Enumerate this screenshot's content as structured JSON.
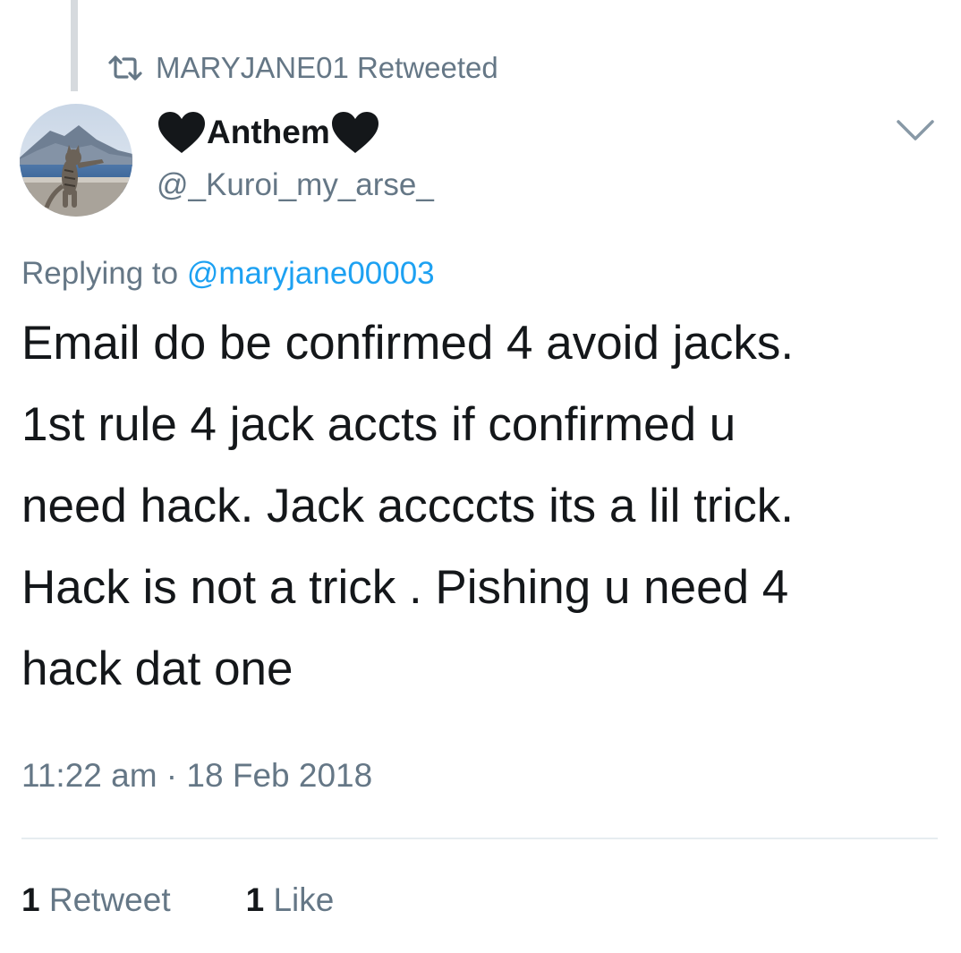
{
  "retweet_banner": {
    "icon": "retweet-icon",
    "text": "MARYJANE01 Retweeted"
  },
  "author": {
    "name": "Anthem",
    "name_decoration_icon": "black-heart-icon",
    "handle": "@_Kuroi_my_arse_",
    "avatar": "cat-on-railing-photo"
  },
  "menu": {
    "icon": "chevron-down-icon"
  },
  "reply": {
    "prefix": "Replying to",
    "mention": "@maryjane00003"
  },
  "tweet": {
    "lines": [
      "Email do be confirmed 4 avoid jacks.",
      "1st rule 4 jack accts if confirmed u",
      "need hack. Jack accccts its a lil trick.",
      "Hack is not a trick . Pishing u need 4",
      "hack dat one"
    ]
  },
  "timestamp": "11:22 am · 18 Feb 2018",
  "stats": {
    "retweets_count": "1",
    "retweets_label": "Retweet",
    "likes_count": "1",
    "likes_label": "Like"
  },
  "colors": {
    "text": "#14171a",
    "secondary": "#657786",
    "link": "#1da1f2",
    "divider": "#e6ecf0",
    "thread_line": "#d6dade"
  }
}
